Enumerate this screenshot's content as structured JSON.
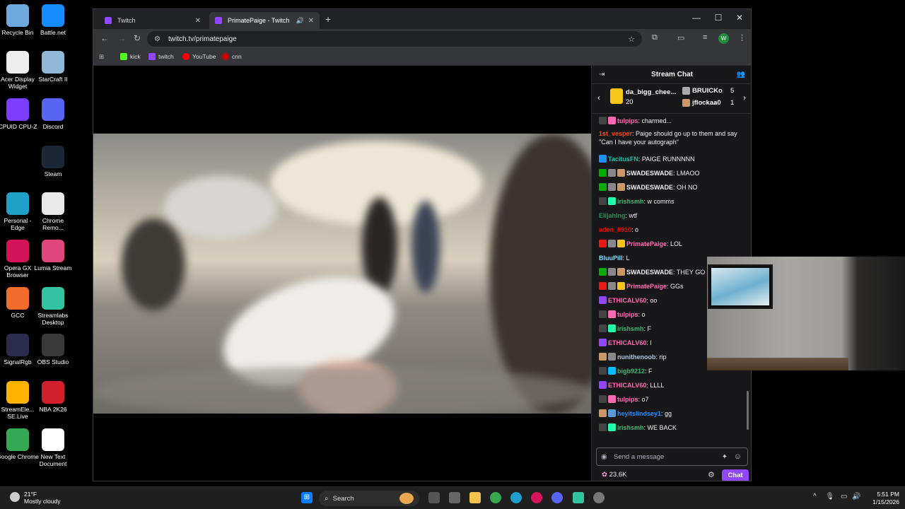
{
  "desktop": {
    "icons": [
      {
        "label": "Recycle Bin",
        "icon": "recycle-bin-icon"
      },
      {
        "label": "Battle.net",
        "icon": "battlenet-icon"
      },
      {
        "label": "Acer Display Widget",
        "icon": "acer-icon"
      },
      {
        "label": "StarCraft II",
        "icon": "starcraft-icon"
      },
      {
        "label": "CPUID CPU-Z",
        "icon": "cpuz-icon"
      },
      {
        "label": "Discord",
        "icon": "discord-icon"
      },
      {
        "label": "Steam",
        "icon": "steam-icon"
      },
      {
        "label": "Personal - Edge",
        "icon": "edge-icon"
      },
      {
        "label": "Chrome Remo...",
        "icon": "chrome-remote-icon"
      },
      {
        "label": "Opera GX Browser",
        "icon": "opera-gx-icon"
      },
      {
        "label": "Lumia Stream",
        "icon": "lumia-icon"
      },
      {
        "label": "GCC",
        "icon": "gcc-icon"
      },
      {
        "label": "Streamlabs Desktop",
        "icon": "streamlabs-icon"
      },
      {
        "label": "SignalRgb",
        "icon": "signalrgb-icon"
      },
      {
        "label": "OBS Studio",
        "icon": "obs-icon"
      },
      {
        "label": "StreamEle... SE.Live",
        "icon": "streamelements-icon"
      },
      {
        "label": "NBA 2K26",
        "icon": "nba2k-icon"
      },
      {
        "label": "Google Chrome",
        "icon": "chrome-icon"
      },
      {
        "label": "New Text Document",
        "icon": "text-doc-icon"
      }
    ]
  },
  "browser": {
    "tabs": [
      {
        "title": "Twitch",
        "active": false
      },
      {
        "title": "PrimatePaige - Twitch",
        "active": true
      }
    ],
    "url": "twitch.tv/primatepaige",
    "profile_initial": "W",
    "bookmarks": [
      {
        "label": "kick",
        "color": "#53fc18"
      },
      {
        "label": "twitch",
        "color": "#9146ff"
      },
      {
        "label": "YouTube",
        "color": "#ff0000"
      },
      {
        "label": "cnn",
        "color": "#cc0000"
      }
    ]
  },
  "chat": {
    "title": "Stream Chat",
    "leaderboard": {
      "top_name": "da_bigg_chee...",
      "top_count": "20",
      "second_name": "BRUICKo",
      "second_count": "5",
      "third_name": "jflockaa0",
      "third_count": "1"
    },
    "messages": [
      {
        "user": "tulpips",
        "color": "#ff69b4",
        "text": ": charmed...",
        "badges": [
          "#444",
          "#ff69b4"
        ]
      },
      {
        "user": "1st_vesper",
        "color": "#ff4500",
        "text": ": Paige should go up to them and say \"Can I have your autograph\"",
        "badges": []
      },
      {
        "user": "TacitusFN",
        "color": "#00c8af",
        "text": ": PAIGE RUNNNNN",
        "badges": [
          "#1e90ff"
        ]
      },
      {
        "user": "SWADESWADE",
        "color": "#efeff1",
        "text": ": LMAOO",
        "badges": [
          "#00ad03",
          "#888",
          "#c96"
        ]
      },
      {
        "user": "SWADESWADE",
        "color": "#efeff1",
        "text": ": OH NO",
        "badges": [
          "#00ad03",
          "#888",
          "#c96"
        ]
      },
      {
        "user": "irishsmh",
        "color": "#3cb371",
        "text": ": w comms",
        "badges": [
          "#444",
          "#2fa"
        ]
      },
      {
        "user": "Elijahlng",
        "color": "#2e8b57",
        "text": ": wtf",
        "badges": []
      },
      {
        "user": "aden_8910",
        "color": "#ff0000",
        "text": ": o",
        "badges": []
      },
      {
        "user": "PrimatePaige",
        "color": "#ff69b4",
        "text": ": LOL",
        "badges": [
          "#e91916",
          "#888",
          "#f5c518"
        ]
      },
      {
        "user": "BluuPill",
        "color": "#7fdbff",
        "text": ": L",
        "badges": []
      },
      {
        "user": "SWADESWADE",
        "color": "#efeff1",
        "text": ": THEY GO",
        "badges": [
          "#00ad03",
          "#888",
          "#c96"
        ]
      },
      {
        "user": "PrimatePaige",
        "color": "#ff69b4",
        "text": ": GGs",
        "badges": [
          "#e91916",
          "#888",
          "#f5c518"
        ]
      },
      {
        "user": "ETHICALV60",
        "color": "#ff69b4",
        "text": ": oo",
        "badges": [
          "#9146ff"
        ]
      },
      {
        "user": "tulpips",
        "color": "#ff69b4",
        "text": ": o",
        "badges": [
          "#444",
          "#ff69b4"
        ]
      },
      {
        "user": "irishsmh",
        "color": "#3cb371",
        "text": ": F",
        "badges": [
          "#444",
          "#2fa"
        ]
      },
      {
        "user": "ETHICALV60",
        "color": "#ff69b4",
        "text": ": l",
        "badges": [
          "#9146ff"
        ]
      },
      {
        "user": "nunithenoob",
        "color": "#b0c4de",
        "text": ": rip",
        "badges": [
          "#c96",
          "#888"
        ]
      },
      {
        "user": "bigb9212",
        "color": "#3cb371",
        "text": ": F",
        "badges": [
          "#444",
          "#00bfff"
        ]
      },
      {
        "user": "ETHICALV60",
        "color": "#ff69b4",
        "text": ": LLLL",
        "badges": [
          "#9146ff"
        ]
      },
      {
        "user": "tulpips",
        "color": "#ff69b4",
        "text": ": o7",
        "badges": [
          "#444",
          "#ff69b4"
        ]
      },
      {
        "user": "heyitslindsey1",
        "color": "#1e90ff",
        "text": ": gg",
        "badges": [
          "#c96",
          "#5b9bd5"
        ]
      },
      {
        "user": "irishsmh",
        "color": "#3cb371",
        "text": ": WE BACK",
        "badges": [
          "#444",
          "#2fa"
        ]
      }
    ],
    "input_placeholder": "Send a message",
    "points": "23.6K",
    "chat_button": "Chat"
  },
  "taskbar": {
    "weather_temp": "21°F",
    "weather_desc": "Mostly cloudy",
    "search_label": "Search",
    "time": "5:51 PM",
    "date": "1/15/2026"
  },
  "colors": {
    "twitch_purple": "#9147ff",
    "chat_bg": "#18181b"
  }
}
